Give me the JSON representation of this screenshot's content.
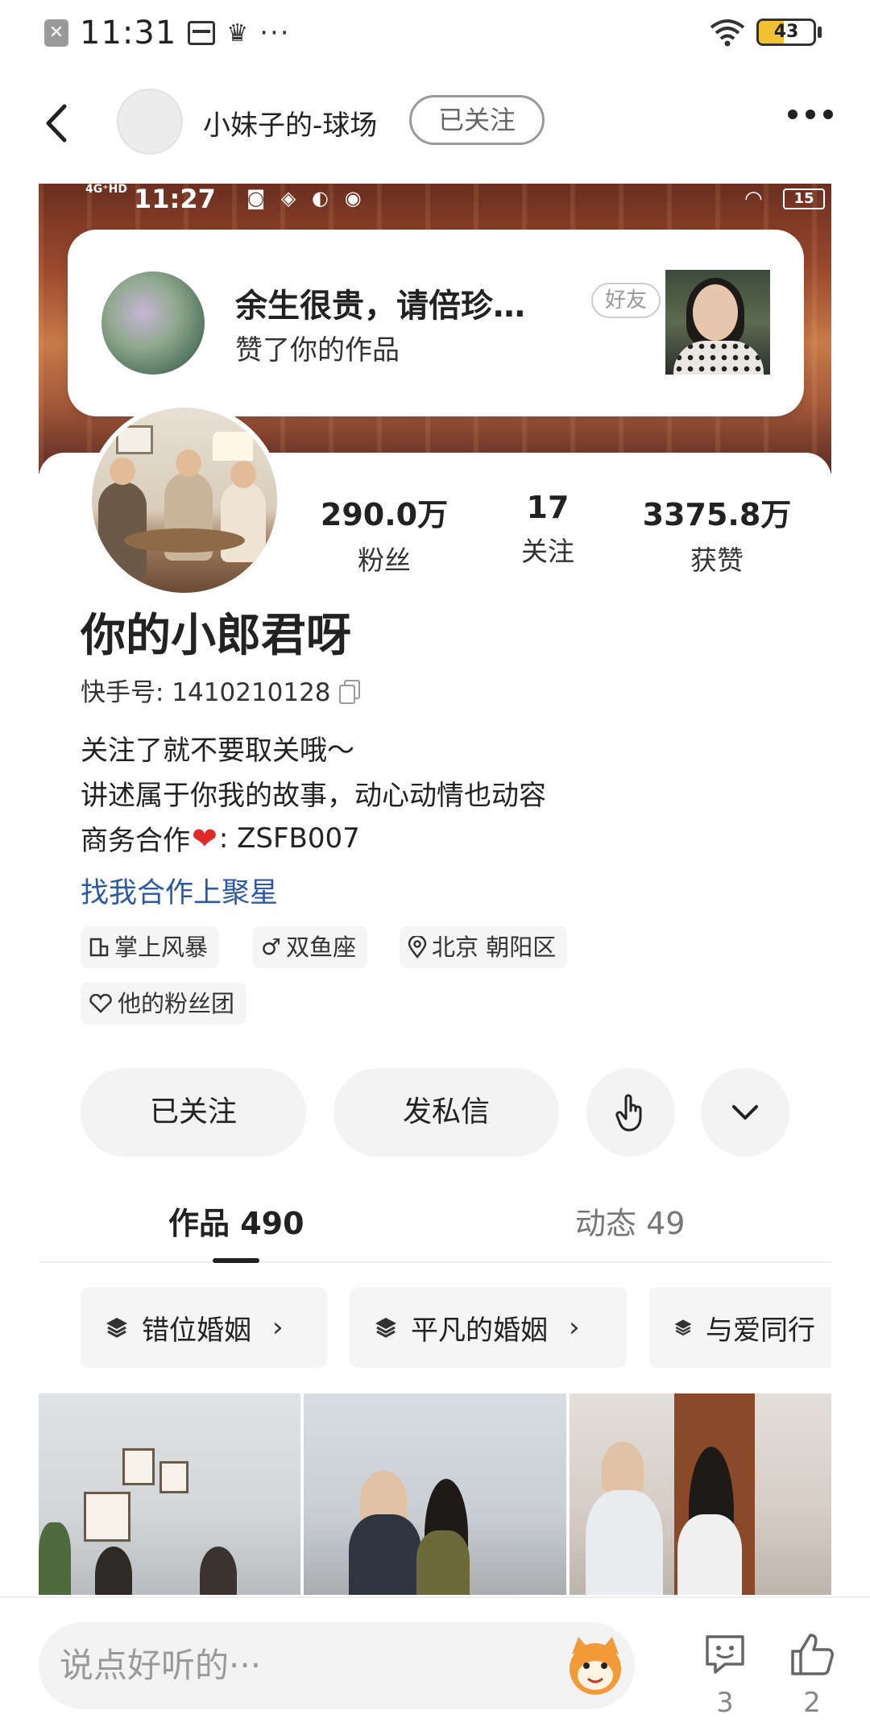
{
  "status_bar": {
    "time": "11:31",
    "battery": "43",
    "more": "···"
  },
  "nav": {
    "title": "小妹子的-球场",
    "follow_label": "已关注"
  },
  "banner": {
    "inner_time": "11:27",
    "inner_signal": "4G⁺HD",
    "inner_battery": "15",
    "notification": {
      "title": "余生很贵，请倍珍…",
      "subtitle": "赞了你的作品",
      "badge": "好友"
    }
  },
  "profile": {
    "stats": [
      {
        "value": "290.0万",
        "label": "粉丝"
      },
      {
        "value": "17",
        "label": "关注"
      },
      {
        "value": "3375.8万",
        "label": "获赞"
      }
    ],
    "username": "你的小郎君呀",
    "id_label": "快手号: 1410210128",
    "bio_lines": [
      "关注了就不要取关哦～",
      "讲述属于你我的故事，动心动情也动容"
    ],
    "bio_business_prefix": "商务合作",
    "bio_business_suffix": ": ZSFB007",
    "link_text": "找我合作上聚星",
    "tags": [
      {
        "icon": "store-icon",
        "text": "掌上风暴"
      },
      {
        "icon": "male-icon",
        "text": "双鱼座"
      },
      {
        "icon": "location-icon",
        "text": "北京 朝阳区"
      },
      {
        "icon": "fan-club-icon",
        "text": "他的粉丝团"
      }
    ]
  },
  "actions": {
    "followed": "已关注",
    "message": "发私信"
  },
  "tabs": [
    {
      "label": "作品 490",
      "active": true
    },
    {
      "label": "动态 49",
      "active": false
    }
  ],
  "collections": [
    {
      "label": "错位婚姻"
    },
    {
      "label": "平凡的婚姻"
    },
    {
      "label": "与爱同行"
    }
  ],
  "bottom_bar": {
    "comment_placeholder": "说点好听的···",
    "comment_count": "3",
    "like_count": "2"
  },
  "colors": {
    "link": "#2c5aa0",
    "heart": "#e02a2a",
    "battery": "#f2c233"
  }
}
